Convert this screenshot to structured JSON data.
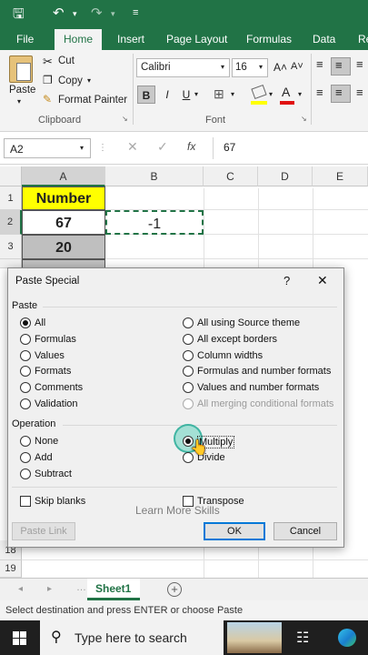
{
  "qat": {
    "save_icon": "save-icon",
    "undo_icon": "undo-icon",
    "redo_icon": "redo-icon",
    "customize_icon": "customize-qat-icon"
  },
  "ribbon_tabs": [
    "File",
    "Home",
    "Insert",
    "Page Layout",
    "Formulas",
    "Data",
    "Re"
  ],
  "active_tab": "Home",
  "clipboard": {
    "paste": "Paste",
    "cut": "Cut",
    "copy": "Copy",
    "format_painter": "Format Painter",
    "group": "Clipboard"
  },
  "font": {
    "name": "Calibri",
    "size": "16",
    "bold": "B",
    "italic": "I",
    "underline": "U",
    "group": "Font"
  },
  "formula_bar": {
    "name_box": "A2",
    "fx": "fx",
    "value": "67"
  },
  "columns": [
    "A",
    "B",
    "C",
    "D",
    "E"
  ],
  "rows": [
    "1",
    "2",
    "3",
    "",
    "18",
    "19"
  ],
  "cells": {
    "a1": "Number",
    "a2": "67",
    "b2": "-1",
    "a3": "20"
  },
  "sheet_tab": "Sheet1",
  "status_text": "Select destination and press ENTER or choose Paste",
  "taskbar": {
    "search_placeholder": "Type here to search"
  },
  "dialog": {
    "title": "Paste Special",
    "help": "?",
    "close": "✕",
    "paste_section": "Paste",
    "paste_left": [
      "All",
      "Formulas",
      "Values",
      "Formats",
      "Comments",
      "Validation"
    ],
    "paste_right": [
      "All using Source theme",
      "All except borders",
      "Column widths",
      "Formulas and number formats",
      "Values and number formats",
      "All merging conditional formats"
    ],
    "paste_selected": "All",
    "operation_section": "Operation",
    "op_left": [
      "None",
      "Add",
      "Subtract"
    ],
    "op_right": [
      "Multiply",
      "Divide"
    ],
    "op_selected": "Multiply",
    "skip_blanks": "Skip blanks",
    "transpose": "Transpose",
    "paste_link": "Paste Link",
    "ok": "OK",
    "cancel": "Cancel",
    "watermark": "Learn More Skills"
  },
  "colors": {
    "excel_green": "#217346",
    "header_fill": "#ffff00",
    "gray_fill": "#bfbfbf"
  }
}
